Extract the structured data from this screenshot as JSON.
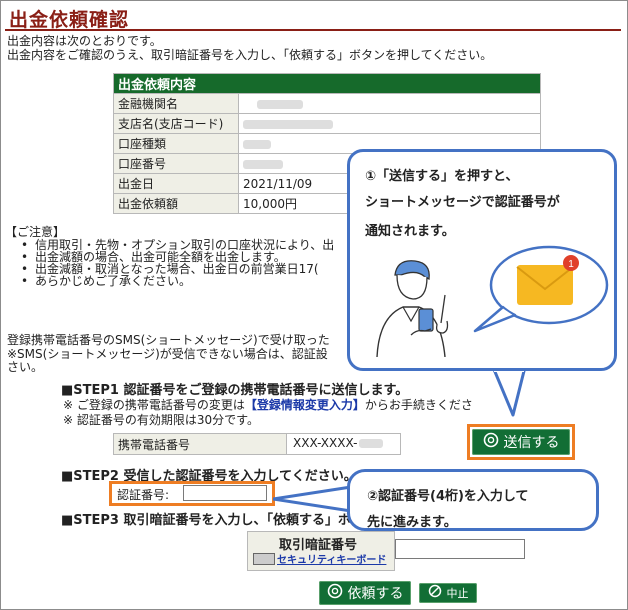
{
  "page": {
    "title": "出金依頼確認",
    "intro_line1": "出金内容は次のとおりです。",
    "intro_line2": "出金内容をご確認のうえ、取引暗証番号を入力し、「依頼する」ボタンを押してください。"
  },
  "detail": {
    "header": "出金依頼内容",
    "rows": [
      {
        "label": "金融機関名",
        "value": ""
      },
      {
        "label": "支店名(支店コード)",
        "value": ""
      },
      {
        "label": "口座種類",
        "value": ""
      },
      {
        "label": "口座番号",
        "value": ""
      },
      {
        "label": "出金日",
        "value": "2021/11/09"
      },
      {
        "label": "出金依頼額",
        "value": "10,000円"
      }
    ]
  },
  "caution": {
    "title": "【ご注意】",
    "items": [
      "信用取引・先物・オプション取引の口座状況により、出",
      "出金減額の場合、出金可能全額を出金します。",
      "出金減額・取消となった場合、出金日の前営業日17(",
      "あらかじめご了承ください。"
    ]
  },
  "registration": {
    "line1": "登録携帯電話番号のSMS(ショートメッセージ)で受け取った",
    "line2": "※SMS(ショートメッセージ)が受信できない場合は、認証設",
    "line3": "さい。"
  },
  "step1": {
    "heading": "■STEP1 認証番号をご登録の携帯電話番号に送信します。",
    "note1_prefix": "※ ご登録の携帯電話番号の変更は",
    "note1_link": "【登録情報変更入力】",
    "note1_suffix": "からお手続きくださ",
    "note2": "※ 認証番号の有効期限は30分です。",
    "phone_label": "携帯電話番号",
    "phone_value": "XXX-XXXX-",
    "send_button": "送信する"
  },
  "step2": {
    "heading": "■STEP2 受信した認証番号を入力してください。",
    "code_label": "認証番号:",
    "code_value": ""
  },
  "step3": {
    "heading": "■STEP3 取引暗証番号を入力し、「依頼する」ボ",
    "pin_label": "取引暗証番号",
    "keyboard_link": "セキュリティキーボード",
    "pin_value": ""
  },
  "actions": {
    "request_button": "依頼する",
    "cancel_button": "中止"
  },
  "callouts": {
    "bubble1_line1": "①「送信する」を押すと、",
    "bubble1_line2": "ショートメッセージで認証番号が",
    "bubble1_line3": "通知されます。",
    "badge_count": "1",
    "bubble2_line1": "②認証番号(4桁)を入力して",
    "bubble2_line2": "先に進みます。"
  },
  "colors": {
    "title": "#8a1f16",
    "table_header": "#166a2b",
    "button": "#126e35",
    "highlight": "#ee7d23",
    "callout_border": "#4472c4",
    "link": "#1b39a8"
  },
  "icons": [
    "check-circle-icon",
    "cancel-circle-icon",
    "keyboard-icon",
    "envelope-icon",
    "notification-badge-icon",
    "person-with-phone-icon"
  ]
}
